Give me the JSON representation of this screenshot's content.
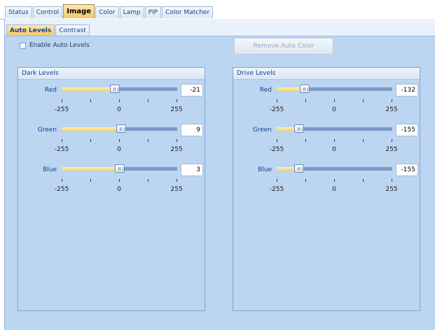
{
  "main_tabs": [
    "Status",
    "Control",
    "Image",
    "Color",
    "Lamp",
    "PIP",
    "Color Matcher"
  ],
  "active_main_tab": "Image",
  "sub_tabs": [
    "Auto Levels",
    "Contrast"
  ],
  "active_sub_tab": "Auto Levels",
  "enable_auto_levels": {
    "label": "Enable Auto Levels",
    "checked": false
  },
  "remove_auto_color": {
    "label": "Remove Auto Color",
    "enabled": false
  },
  "groups": [
    {
      "title": "Dark Levels",
      "sliders": [
        {
          "label": "Red",
          "value": -21,
          "min": -255,
          "max": 255
        },
        {
          "label": "Green",
          "value": 9,
          "min": -255,
          "max": 255
        },
        {
          "label": "Blue",
          "value": 3,
          "min": -255,
          "max": 255
        }
      ]
    },
    {
      "title": "Drive Levels",
      "sliders": [
        {
          "label": "Red",
          "value": -132,
          "min": -255,
          "max": 255
        },
        {
          "label": "Green",
          "value": -155,
          "min": -255,
          "max": 255
        },
        {
          "label": "Blue",
          "value": -155,
          "min": -255,
          "max": 255
        }
      ]
    }
  ],
  "scale_labels": {
    "min": "-255",
    "mid": "0",
    "max": "255"
  },
  "colors": {
    "panel_bg": "#bcd5f1",
    "active_tab": "#f6c768",
    "slider_fill": "#f7d26c",
    "slider_track": "#7c98c4"
  }
}
